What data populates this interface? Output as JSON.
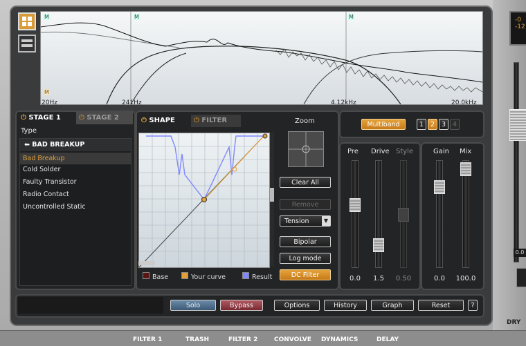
{
  "spectrum": {
    "band_markers": [
      "M",
      "M",
      "M",
      "M"
    ],
    "freq_labels": [
      "20Hz",
      "241Hz",
      "4.12kHz",
      "20.0kHz"
    ]
  },
  "stages": {
    "tabs": [
      "STAGE 1",
      "STAGE 2"
    ],
    "type_label": "Type",
    "preset_header": "BAD BREAKUP",
    "presets": [
      "Bad Breakup",
      "Cold Solder",
      "Faulty Transistor",
      "Radio Contact",
      "Uncontrolled Static"
    ],
    "selected_index": 0
  },
  "shape_panel": {
    "tabs": [
      "SHAPE",
      "FILTER"
    ],
    "zoom_label": "Zoom",
    "buttons": {
      "clear_all": "Clear All",
      "remove": "Remove",
      "tension": "Tension",
      "bipolar": "Bipolar",
      "log_mode": "Log mode",
      "dc_filter": "DC Filter"
    },
    "legend": [
      "Base",
      "Your curve",
      "Result"
    ],
    "colors": {
      "base": "#5a1414",
      "curve": "#e0a03a",
      "result": "#7f88ff"
    }
  },
  "multiband": {
    "label": "Multiband",
    "bands": [
      "1",
      "2",
      "3",
      "4"
    ],
    "active_band": "2"
  },
  "sliders": {
    "labels": [
      "Pre",
      "Drive",
      "Style",
      "Gain",
      "Mix"
    ],
    "values": [
      "0.0",
      "1.5",
      "0.50",
      "0.0",
      "100.0"
    ]
  },
  "footer": {
    "solo": "Solo",
    "bypass": "Bypass",
    "options": "Options",
    "history": "History",
    "graph": "Graph",
    "reset": "Reset",
    "help": "?"
  },
  "right_strip": {
    "top_readout_1": "-0",
    "top_readout_2": "-12",
    "mid_readout": "0.0",
    "dry": "DRY"
  },
  "bottom_modules": [
    "FILTER 1",
    "TRASH",
    "FILTER 2",
    "CONVOLVE",
    "DYNAMICS",
    "DELAY"
  ]
}
